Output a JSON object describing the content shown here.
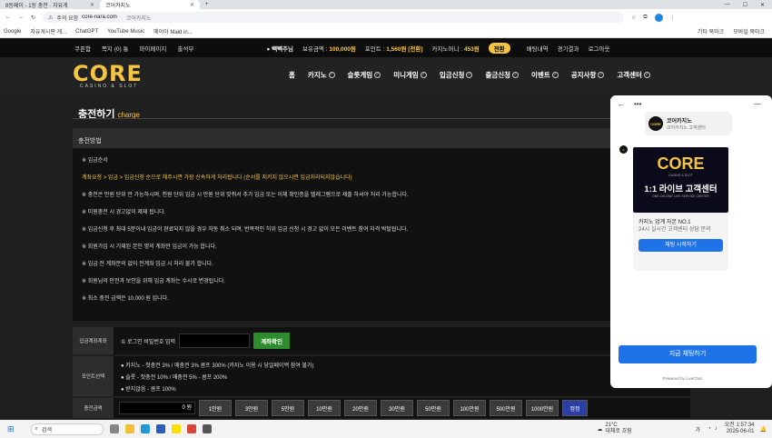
{
  "browser": {
    "tabs": [
      {
        "title": "8등페이 - 1등 충전 · 자유게",
        "active": false
      },
      {
        "title": "코어카지노",
        "active": true
      }
    ],
    "url_security": "주의 요함",
    "url_host": "core-nara.com",
    "url_site": "코어카지노",
    "bookmarks": [
      "Google",
      "자유게시판 게...",
      "ChatGPT",
      "YouTube Music",
      "메이아 Maid in..."
    ],
    "bookmarks_right": [
      "기타 북마크",
      "모바일 북마크"
    ]
  },
  "topbar": {
    "nav": [
      "쿠폰함",
      "쪽지 (0) 통",
      "마이페이지",
      "출석부"
    ],
    "user": "빽빽주님",
    "balance_label": "보유금액 :",
    "balance": "100,000원",
    "point_label": "포인트 :",
    "point": "1,560원 [전환]",
    "casino_money_label": "카지노머니 :",
    "casino_money": "453원",
    "convert": "전환",
    "right": [
      "배팅내역",
      "경기결과",
      "로그아웃"
    ]
  },
  "header": {
    "logo_main": "CORE",
    "logo_sub": "CASINO & SLOT",
    "menu": [
      "홈",
      "카지노",
      "슬롯게임",
      "미니게임",
      "입금신청",
      "출금신청",
      "이벤트",
      "공지사항",
      "고객센터"
    ]
  },
  "page": {
    "title": "충전하기",
    "title_en": "charge",
    "method_head": "충전방법",
    "rules": [
      "※ 입금순서",
      "계좌요청 > 입금 > 입금신청 순으로 해주시면 가장 신속하게 처리됩니다 (순서를 지키지 않으시면 입금처리되지않습니다)",
      "※ 충전은 만원 단위 만 가능하시며, 천원 단위 입금 시 만원 단위 맞춰서 추가 입금 또는 이체 확인증을 텔레그램으로 제출 하셔야 처리 가능합니다.",
      "※ 미원충전 시 경고없이 제재 됩니다.",
      "※ 입금신청 후 최대 5분이내 입금이 완료되지 않을 경우 자동 취소 되며, 반복적인 허위 입금 신청 시 경고 없이 모든 이벤트 참여 자격 박탈됩니다.",
      "※ 회원가입 시 기재된 본인 명의 계좌만 입금이 가능 합니다.",
      "※ 입금 전 계좌문의 없이 전계좌 입금 시 처리 불가 합니다.",
      "※ 회원님의 안전과 보안을 위해 입금 계좌는 수시로 변경됩니다.",
      "※ 최소 충전 금액은 10,000 원 입니다."
    ],
    "account_label": "입금계좌계좌",
    "account_prompt": "① 로그인 비밀번호 입력",
    "account_button": "계좌확인",
    "point_select_label": "포인트선택",
    "point_options": [
      "● 카지노 - 첫충전 3% / 매충전 3% 콤프 300% (카지노 이용 시 당일페이백 참여 불가)",
      "● 슬롯 - 첫충전 10% / 매충전 5% - 콤프 200%",
      "● 받지않음 - 콤프 100%"
    ],
    "amount_label": "충전금액",
    "amount_value": "0 원",
    "amount_buttons": [
      "1만원",
      "3만원",
      "5만원",
      "10만원",
      "20만원",
      "30만원",
      "50만원",
      "100만원",
      "500만원",
      "1000만원"
    ],
    "reset": "정정"
  },
  "chat": {
    "agent_name": "코어카지노",
    "agent_sub": "코어카지노 고객센터",
    "banner_logo": "CORE",
    "banner_sub": "CASINO & SLOT",
    "banner_title": "1:1 라이브 고객센터",
    "banner_small": "ONE-ON-ONE LIVE SERVICE CENTER",
    "msg_title": "카지노 업계 자본 NO.1",
    "msg_sub": "24시 실시간 고객센터 상담 문의",
    "msg_button": "채팅 시작하기",
    "start_button": "지금 채팅하기",
    "powered": "Powered by LiveChat"
  },
  "taskbar": {
    "search": "검색",
    "weather_temp": "21°C",
    "weather_desc": "대체로 흐림",
    "time": "오전 1:57:34",
    "date": "2025-06-01",
    "lang": "가"
  }
}
